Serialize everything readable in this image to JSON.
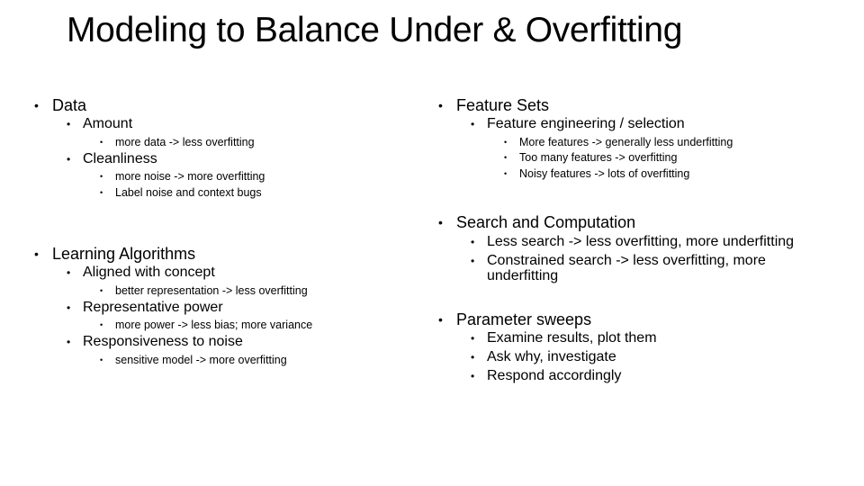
{
  "slide": {
    "title": "Modeling to Balance Under & Overfitting",
    "bullet_glyph": "•",
    "left": {
      "data": {
        "label": "Data",
        "amount": {
          "label": "Amount",
          "items": [
            "more data -> less overfitting"
          ]
        },
        "cleanliness": {
          "label": "Cleanliness",
          "items": [
            "more noise -> more overfitting",
            "Label noise and context bugs"
          ]
        }
      },
      "learning": {
        "label": "Learning Algorithms",
        "aligned": {
          "label": "Aligned with concept",
          "items": [
            "better representation -> less overfitting"
          ]
        },
        "power": {
          "label": "Representative power",
          "items": [
            "more power -> less bias; more variance"
          ]
        },
        "noise": {
          "label": "Responsiveness to noise",
          "items": [
            "sensitive model -> more overfitting"
          ]
        }
      }
    },
    "right": {
      "features": {
        "label": "Feature Sets",
        "engineering": {
          "label": "Feature engineering / selection",
          "items": [
            "More features -> generally less underfitting",
            "Too many features -> overfitting",
            "Noisy features -> lots of overfitting"
          ]
        }
      },
      "search": {
        "label": "Search and Computation",
        "items": [
          "Less search -> less overfitting, more underfitting",
          "Constrained search -> less overfitting, more",
          "underfitting"
        ]
      },
      "sweeps": {
        "label": "Parameter sweeps",
        "items": [
          "Examine results, plot them",
          "Ask why, investigate",
          "Respond accordingly"
        ]
      }
    }
  }
}
